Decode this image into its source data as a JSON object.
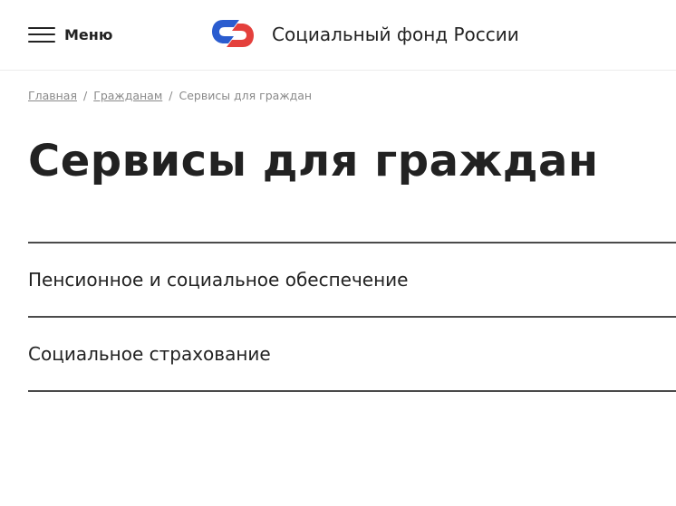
{
  "header": {
    "menu_label": "Меню",
    "brand": "Социальный фонд России",
    "logo_icon": "sfr-logo-icon",
    "logo_colors": {
      "blue": "#2a5ccf",
      "red": "#e4403c"
    }
  },
  "breadcrumb": {
    "items": [
      "Главная",
      "Гражданам"
    ],
    "current": "Сервисы для граждан",
    "separator": "/"
  },
  "page": {
    "title": "Сервисы для граждан"
  },
  "sections": [
    {
      "label": "Пенсионное и социальное обеспечение"
    },
    {
      "label": "Социальное страхование"
    }
  ]
}
